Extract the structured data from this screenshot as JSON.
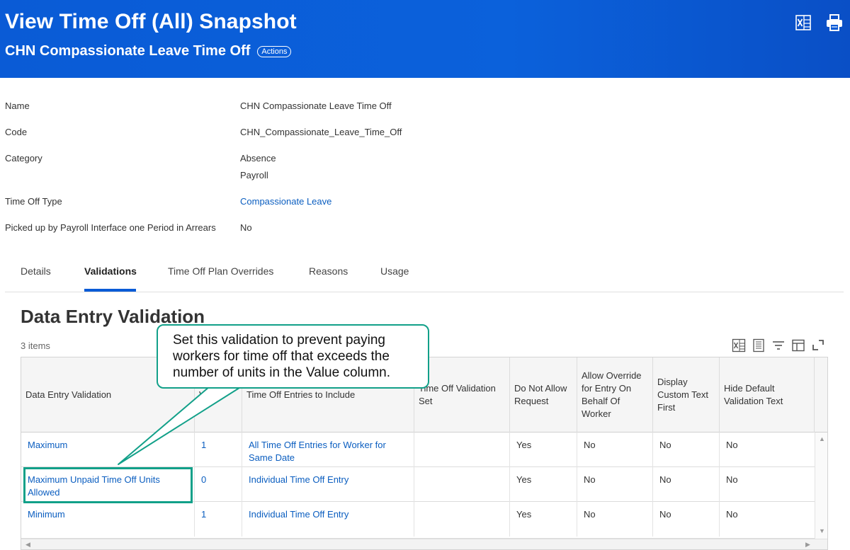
{
  "header": {
    "title": "View Time Off (All) Snapshot",
    "subtitle": "CHN Compassionate Leave Time Off",
    "actions_label": "Actions",
    "icons": [
      "export-to-excel-icon",
      "print-icon"
    ]
  },
  "fields": [
    {
      "label": "Name",
      "values": [
        "CHN Compassionate Leave Time Off"
      ]
    },
    {
      "label": "Code",
      "values": [
        "CHN_Compassionate_Leave_Time_Off"
      ]
    },
    {
      "label": "Category",
      "values": [
        "Absence",
        "Payroll"
      ]
    },
    {
      "label": "Time Off Type",
      "values": [
        "Compassionate Leave"
      ]
    },
    {
      "label": "Picked up by Payroll Interface one Period in Arrears",
      "values": [
        "No"
      ]
    }
  ],
  "tabs": [
    {
      "label": "Details"
    },
    {
      "label": "Validations",
      "active": true
    },
    {
      "label": "Time Off Plan Overrides"
    },
    {
      "label": "Reasons"
    },
    {
      "label": "Usage"
    }
  ],
  "section": {
    "title": "Data Entry Validation",
    "count": "3 items"
  },
  "table": {
    "columns": [
      "Data Entry Validation",
      "Value",
      "Time Off Entries to Include",
      "Time Off Validation Set",
      "Do Not Allow Request",
      "Allow Override for Entry On Behalf Of Worker",
      "Display Custom Text First",
      "Hide Default Validation Text"
    ],
    "rows": [
      [
        "Maximum",
        "1",
        "All Time Off Entries for Worker for Same Date",
        "",
        "Yes",
        "No",
        "No",
        "No"
      ],
      [
        "Maximum Unpaid Time Off Units Allowed",
        "0",
        "Individual Time Off Entry",
        "",
        "Yes",
        "No",
        "No",
        "No"
      ],
      [
        "Minimum",
        "1",
        "Individual Time Off Entry",
        "",
        "Yes",
        "No",
        "No",
        "No"
      ]
    ]
  },
  "callout": {
    "text_lines": [
      "Set this validation to prevent paying",
      "workers for time off that exceeds the",
      "number of units in the Value column."
    ]
  },
  "colors": {
    "header_blue": "#0a5bd6",
    "link_blue": "#0b5ec0",
    "callout_green": "#12a089"
  }
}
